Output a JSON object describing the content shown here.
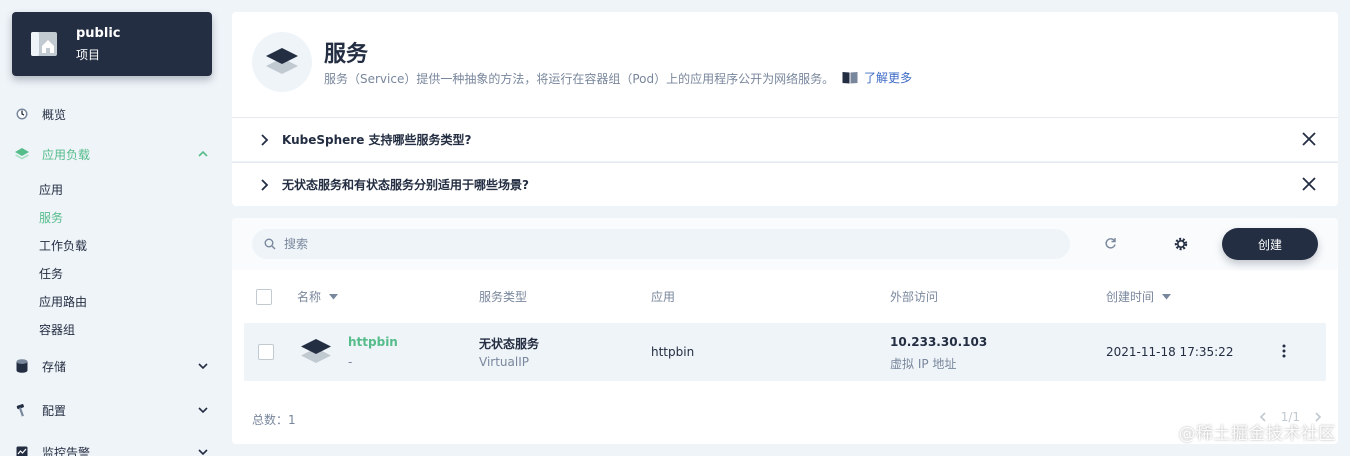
{
  "project": {
    "name": "public",
    "type": "项目"
  },
  "sidebar": {
    "overview": "概览",
    "app_workloads": "应用负载",
    "app_workloads_items": [
      "应用",
      "服务",
      "工作负载",
      "任务",
      "应用路由",
      "容器组"
    ],
    "storage": "存储",
    "config": "配置",
    "monitoring": "监控告警"
  },
  "header": {
    "title": "服务",
    "description": "服务（Service）提供一种抽象的方法，将运行在容器组（Pod）上的应用程序公开为网络服务。",
    "learn_more": "了解更多"
  },
  "faq": [
    "KubeSphere 支持哪些服务类型?",
    "无状态服务和有状态服务分别适用于哪些场景?"
  ],
  "toolbar": {
    "search_placeholder": "搜索",
    "create_label": "创建"
  },
  "table": {
    "columns": [
      "名称",
      "服务类型",
      "应用",
      "外部访问",
      "创建时间"
    ],
    "rows": [
      {
        "name": "httpbin",
        "desc": "-",
        "type": "无状态服务",
        "type_sub": "VirtualIP",
        "app": "httpbin",
        "external": "10.233.30.103",
        "external_sub": "虚拟 IP 地址",
        "created": "2021-11-18 17:35:22"
      }
    ]
  },
  "footer": {
    "total": "总数：1",
    "page": "1/1"
  },
  "watermark": "@稀土掘金技术社区",
  "colors": {
    "accent": "#55bc8a",
    "dark": "#242e42",
    "muted": "#79879c",
    "bg": "#eff4f9"
  }
}
